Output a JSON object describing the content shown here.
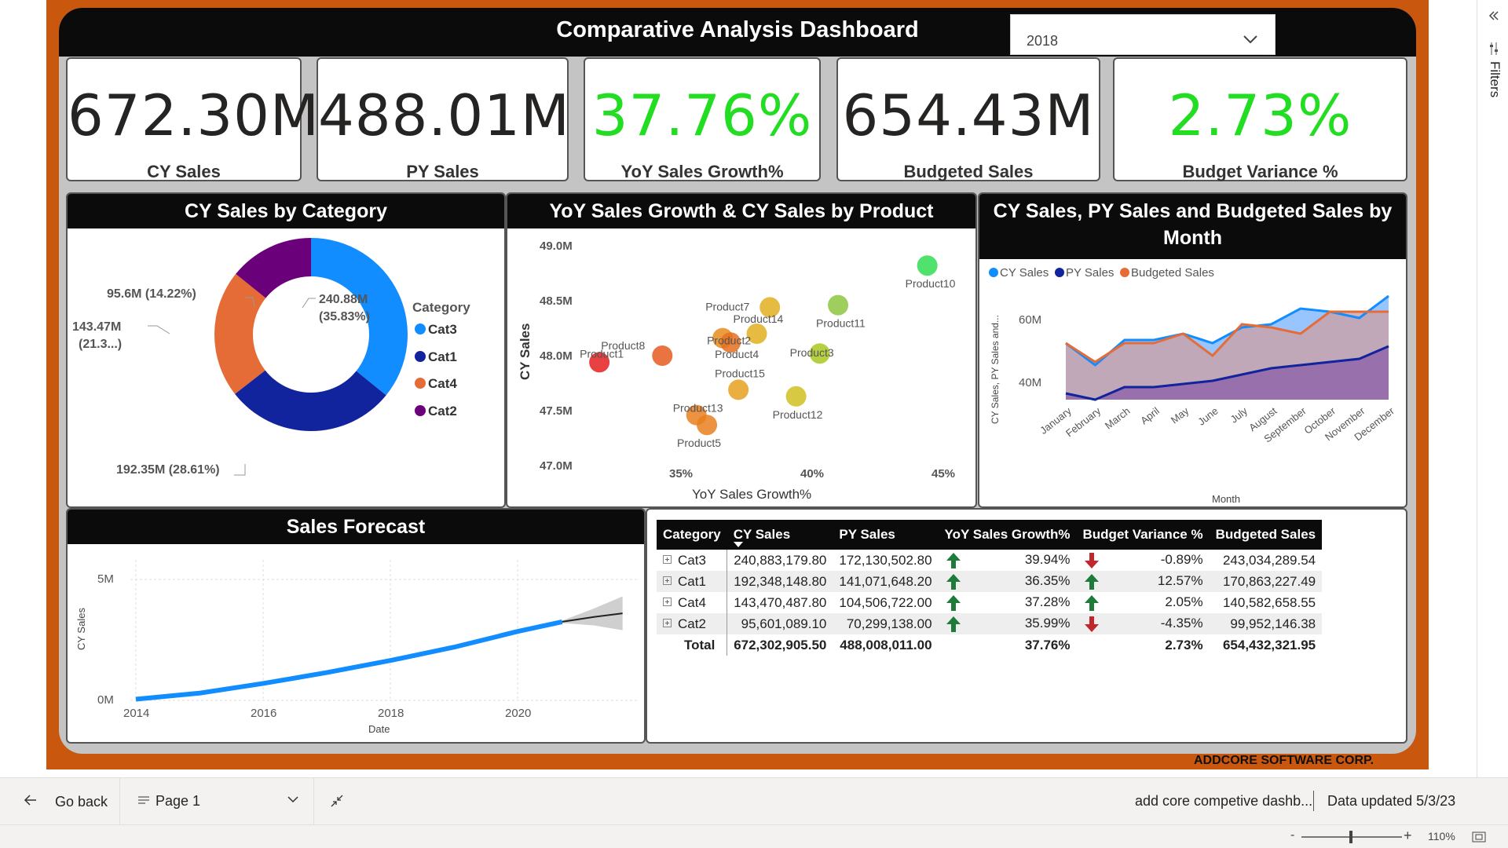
{
  "dashboard": {
    "title": "Comparative Analysis Dashboard",
    "year_slicer": {
      "selected": "2018"
    },
    "footer": "ADDCORE SOFTWARE CORP."
  },
  "kpis": [
    {
      "value": "672.30M",
      "label": "CY Sales",
      "color": "#252423"
    },
    {
      "value": "488.01M",
      "label": "PY Sales",
      "color": "#252423"
    },
    {
      "value": "37.76%",
      "label": "YoY Sales Growth%",
      "color": "#22dd22"
    },
    {
      "value": "654.43M",
      "label": "Budgeted Sales",
      "color": "#252423"
    },
    {
      "value": "2.73%",
      "label": "Budget Variance %",
      "color": "#22dd22"
    }
  ],
  "donut": {
    "title": "CY Sales by Category",
    "legend_title": "Category",
    "labels": [
      {
        "line1": "240.88M",
        "line2": "(35.83%)"
      },
      {
        "line1": "192.35M (28.61%)",
        "line2": ""
      },
      {
        "line1": "143.47M",
        "line2": "(21.3...)"
      },
      {
        "line1": "95.6M (14.22%)",
        "line2": ""
      }
    ],
    "legend": [
      {
        "name": "Cat3",
        "color": "#118dff"
      },
      {
        "name": "Cat1",
        "color": "#12239e"
      },
      {
        "name": "Cat4",
        "color": "#e66c37"
      },
      {
        "name": "Cat2",
        "color": "#6b007b"
      }
    ]
  },
  "scatter": {
    "title": "YoY Sales Growth & CY Sales by Product",
    "xlabel": "YoY Sales Growth%",
    "ylabel": "CY Sales",
    "xticks": [
      "35%",
      "40%",
      "45%"
    ],
    "yticks": [
      "49.0M",
      "48.5M",
      "48.0M",
      "47.5M",
      "47.0M"
    ]
  },
  "linechart": {
    "title_line1": "CY Sales, PY Sales and Budgeted Sales by",
    "title_line2": "Month",
    "legend": [
      {
        "name": "CY Sales",
        "color": "#118dff"
      },
      {
        "name": "PY Sales",
        "color": "#12239e"
      },
      {
        "name": "Budgeted Sales",
        "color": "#e66c37"
      }
    ],
    "ylabel": "CY Sales, PY Sales and...",
    "xlabel": "Month",
    "yticks": [
      "60M",
      "40M"
    ]
  },
  "forecast": {
    "title": "Sales Forecast",
    "ylabel": "CY Sales",
    "xlabel": "Date",
    "yticks": [
      "5M",
      "0M"
    ],
    "xticks": [
      "2014",
      "2016",
      "2018",
      "2020"
    ]
  },
  "matrix": {
    "columns": [
      "Category",
      "CY Sales",
      "PY Sales",
      "YoY Sales Growth%",
      "Budget Variance %",
      "Budgeted Sales"
    ],
    "rows": [
      {
        "category": "Cat3",
        "cy": "240,883,179.80",
        "py": "172,130,502.80",
        "yoy": "39.94%",
        "yoy_dir": "up",
        "bv": "-0.89%",
        "bv_dir": "down",
        "budget": "243,034,289.54"
      },
      {
        "category": "Cat1",
        "cy": "192,348,148.80",
        "py": "141,071,648.20",
        "yoy": "36.35%",
        "yoy_dir": "up",
        "bv": "12.57%",
        "bv_dir": "up",
        "budget": "170,863,227.49"
      },
      {
        "category": "Cat4",
        "cy": "143,470,487.80",
        "py": "104,506,722.00",
        "yoy": "37.28%",
        "yoy_dir": "up",
        "bv": "2.05%",
        "bv_dir": "up",
        "budget": "140,582,658.55"
      },
      {
        "category": "Cat2",
        "cy": "95,601,089.10",
        "py": "70,299,138.00",
        "yoy": "35.99%",
        "yoy_dir": "up",
        "bv": "-4.35%",
        "bv_dir": "down",
        "budget": "99,952,146.38"
      }
    ],
    "total": {
      "label": "Total",
      "cy": "672,302,905.50",
      "py": "488,008,011.00",
      "yoy": "37.76%",
      "bv": "2.73%",
      "budget": "654,432,321.95"
    }
  },
  "nav": {
    "go_back": "Go back",
    "page": "Page 1",
    "report_name": "add core competive dashb...",
    "data_updated": "Data updated 5/3/23",
    "zoom": "110%",
    "filters": "Filters"
  },
  "chart_data": [
    {
      "type": "pie",
      "title": "CY Sales by Category",
      "categories": [
        "Cat3",
        "Cat1",
        "Cat4",
        "Cat2"
      ],
      "values": [
        240.88,
        192.35,
        143.47,
        95.6
      ],
      "percent": [
        35.83,
        28.61,
        21.3,
        14.22
      ],
      "unit": "M",
      "donut": true,
      "legend_position": "right"
    },
    {
      "type": "scatter",
      "title": "YoY Sales Growth & CY Sales by Product",
      "xlabel": "YoY Sales Growth%",
      "ylabel": "CY Sales",
      "xlim": [
        33,
        47
      ],
      "ylim": [
        47.0,
        49.0
      ],
      "points": [
        {
          "name": "Product10",
          "x": 44.3,
          "y": 48.82,
          "color": "#33dd55"
        },
        {
          "name": "Product11",
          "x": 40.9,
          "y": 48.46,
          "color": "#8dc63f"
        },
        {
          "name": "Product7",
          "x": 38.3,
          "y": 48.44,
          "color": "#e0b020"
        },
        {
          "name": "Product2",
          "x": 36.5,
          "y": 48.16,
          "color": "#e88d20"
        },
        {
          "name": "Product14",
          "x": 37.8,
          "y": 48.2,
          "color": "#e0b020"
        },
        {
          "name": "Product4",
          "x": 36.8,
          "y": 48.12,
          "color": "#e67020"
        },
        {
          "name": "Product3",
          "x": 40.2,
          "y": 48.02,
          "color": "#a8c820"
        },
        {
          "name": "Product8",
          "x": 34.2,
          "y": 48.0,
          "color": "#e65c20"
        },
        {
          "name": "Product1",
          "x": 31.8,
          "y": 47.94,
          "color": "#e52020"
        },
        {
          "name": "Product15",
          "x": 37.1,
          "y": 47.69,
          "color": "#e8a020"
        },
        {
          "name": "Product12",
          "x": 39.3,
          "y": 47.63,
          "color": "#d0c020"
        },
        {
          "name": "Product13",
          "x": 35.5,
          "y": 47.46,
          "color": "#e88020"
        },
        {
          "name": "Product5",
          "x": 35.9,
          "y": 47.37,
          "color": "#e88020"
        }
      ]
    },
    {
      "type": "area",
      "title": "CY Sales, PY Sales and Budgeted Sales by Month",
      "categories": [
        "January",
        "February",
        "March",
        "April",
        "May",
        "June",
        "July",
        "August",
        "September",
        "October",
        "November",
        "December"
      ],
      "series": [
        {
          "name": "CY Sales",
          "values": [
            52,
            45,
            53,
            53,
            55,
            52,
            57,
            58,
            63,
            62,
            60,
            67
          ]
        },
        {
          "name": "PY Sales",
          "values": [
            36,
            34,
            38,
            38,
            39,
            40,
            42,
            44,
            45,
            46,
            47,
            51
          ]
        },
        {
          "name": "Budgeted Sales",
          "values": [
            52,
            46,
            52,
            52,
            55,
            48,
            58,
            57,
            55,
            62,
            62,
            62
          ]
        }
      ],
      "ylim": [
        30,
        70
      ],
      "legend_position": "top-left"
    },
    {
      "type": "line",
      "title": "Sales Forecast",
      "xlabel": "Date",
      "ylabel": "CY Sales",
      "xlim": [
        2014,
        2021.7
      ],
      "ylim": [
        0,
        5.6
      ],
      "series": [
        {
          "name": "CY Sales",
          "x": [
            2014.0,
            2015.0,
            2016.0,
            2017.0,
            2018.0,
            2019.0,
            2020.0,
            2020.7
          ],
          "values": [
            0.05,
            0.3,
            0.7,
            1.15,
            1.65,
            2.2,
            2.85,
            3.25
          ]
        },
        {
          "name": "forecast",
          "x": [
            2020.7,
            2021.2,
            2021.65
          ],
          "values": [
            3.25,
            3.45,
            3.6
          ]
        }
      ]
    }
  ]
}
